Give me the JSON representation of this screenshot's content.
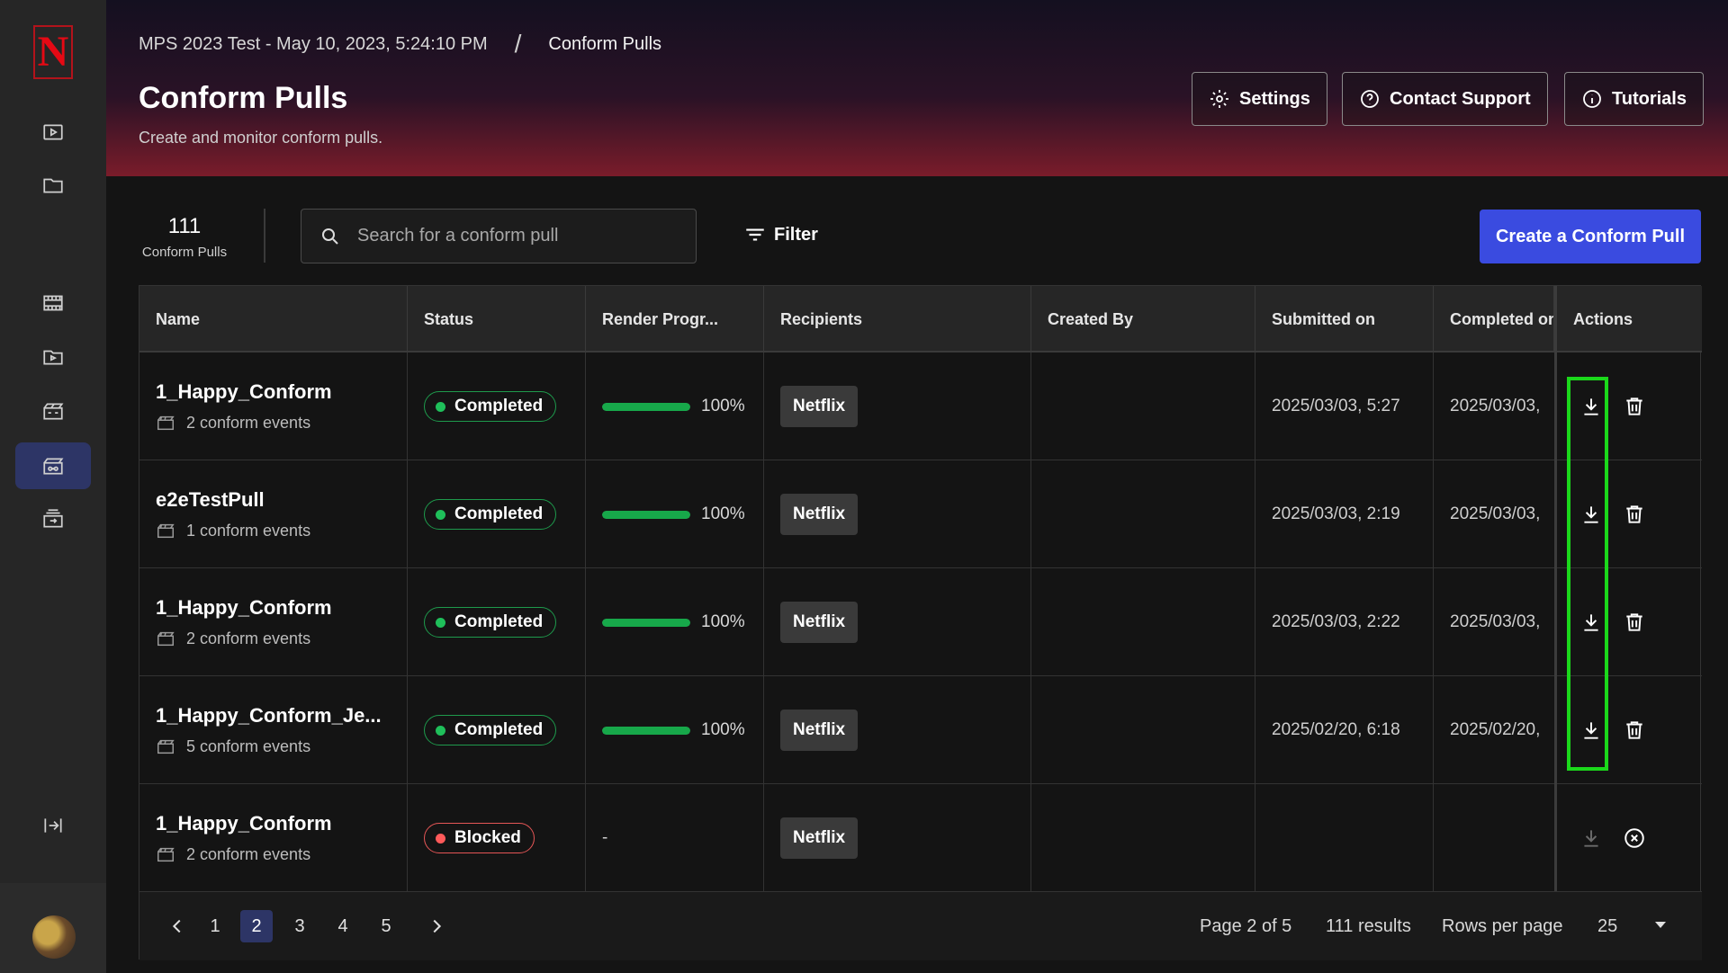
{
  "app": {
    "logo_letter": "N"
  },
  "breadcrumb": {
    "parent": "MPS 2023 Test - May 10, 2023, 5:24:10 PM",
    "separator": "/",
    "current": "Conform Pulls"
  },
  "header": {
    "title": "Conform Pulls",
    "subtitle": "Create and monitor conform pulls.",
    "settings_label": "Settings",
    "support_label": "Contact Support",
    "tutorials_label": "Tutorials"
  },
  "toolbar": {
    "count": "111",
    "count_label": "Conform Pulls",
    "search_placeholder": "Search for a conform pull",
    "filter_label": "Filter",
    "create_label": "Create a Conform Pull"
  },
  "table": {
    "columns": [
      "Name",
      "Status",
      "Render Progr...",
      "Recipients",
      "Created By",
      "Submitted on",
      "Completed on",
      "Actions"
    ],
    "rows": [
      {
        "name": "1_Happy_Conform",
        "events": "2 conform events",
        "status": "Completed",
        "progress_label": "100%",
        "progress": 1.0,
        "recipient": "Netflix",
        "created_by": "",
        "submitted": "2025/03/03, 5:27",
        "completed": "2025/03/03,"
      },
      {
        "name": "e2eTestPull",
        "events": "1 conform events",
        "status": "Completed",
        "progress_label": "100%",
        "progress": 1.0,
        "recipient": "Netflix",
        "created_by": "",
        "submitted": "2025/03/03, 2:19",
        "completed": "2025/03/03,"
      },
      {
        "name": "1_Happy_Conform",
        "events": "2 conform events",
        "status": "Completed",
        "progress_label": "100%",
        "progress": 1.0,
        "recipient": "Netflix",
        "created_by": "",
        "submitted": "2025/03/03, 2:22",
        "completed": "2025/03/03,"
      },
      {
        "name": "1_Happy_Conform_Je...",
        "events": "5 conform events",
        "status": "Completed",
        "progress_label": "100%",
        "progress": 1.0,
        "recipient": "Netflix",
        "created_by": "",
        "submitted": "2025/02/20, 6:18",
        "completed": "2025/02/20,"
      },
      {
        "name": "1_Happy_Conform",
        "events": "2 conform events",
        "status": "Blocked",
        "progress_label": "-",
        "progress": null,
        "recipient": "Netflix",
        "created_by": "",
        "submitted": "",
        "completed": ""
      }
    ]
  },
  "pagination": {
    "pages": [
      "1",
      "2",
      "3",
      "4",
      "5"
    ],
    "current_page": "2",
    "page_info": "Page 2 of 5",
    "results": "111 results",
    "rows_per_page_label": "Rows per page",
    "rows_per_page": "25"
  },
  "colors": {
    "accent": "#3a4be0",
    "completed": "#1fbf5a",
    "blocked": "#ff5a5a",
    "highlight": "#1bd81b",
    "brand": "#e50914"
  }
}
